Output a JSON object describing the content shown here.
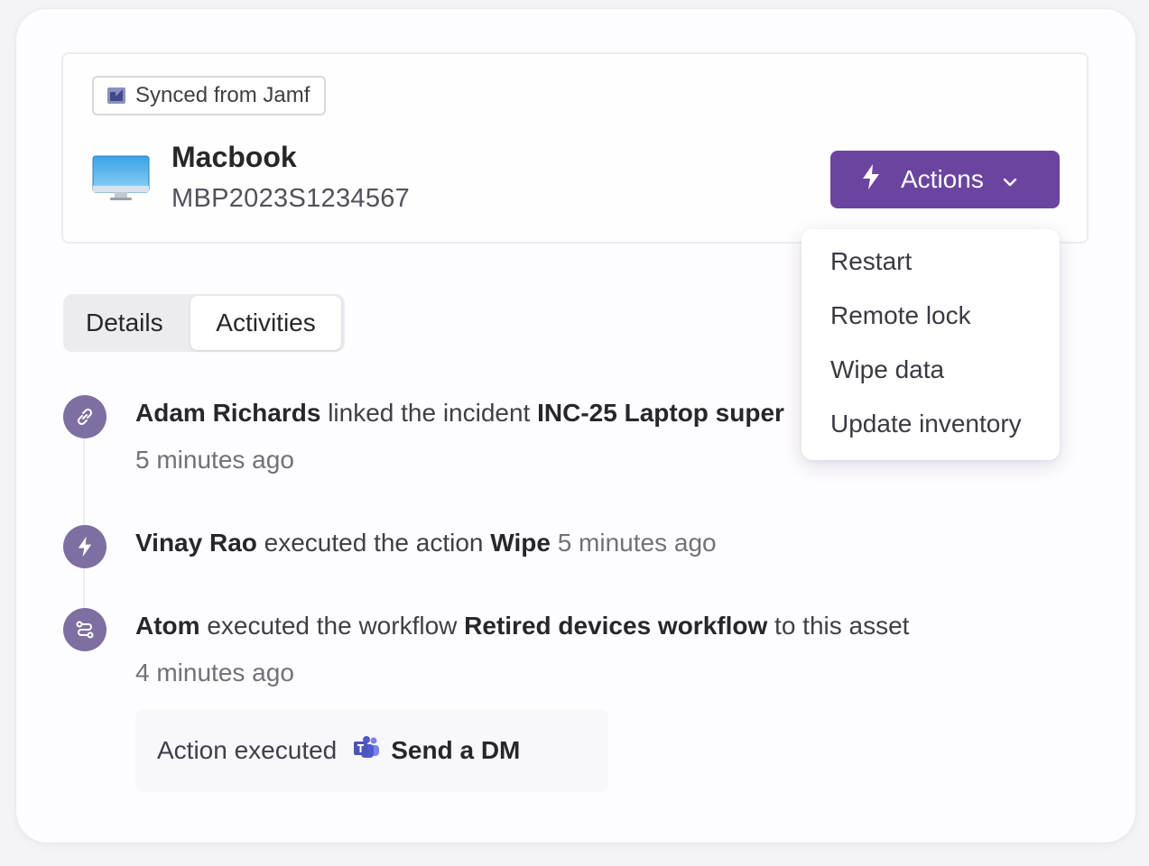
{
  "asset": {
    "sync_badge": "Synced from Jamf",
    "name": "Macbook",
    "serial": "MBP2023S1234567",
    "actions_label": "Actions"
  },
  "actions_menu": {
    "items": [
      "Restart",
      "Remote lock",
      "Wipe data",
      "Update inventory"
    ]
  },
  "tabs": {
    "details": "Details",
    "activities": "Activities",
    "active": "Activities"
  },
  "activities": [
    {
      "icon": "link-icon",
      "actor": "Adam Richards",
      "verb": "linked the incident",
      "object": "INC-25 Laptop super",
      "time": "5 minutes ago"
    },
    {
      "icon": "bolt-icon",
      "actor": "Vinay Rao",
      "verb": "executed the action",
      "object": "Wipe",
      "time": "5 minutes ago"
    },
    {
      "icon": "workflow-icon",
      "actor": "Atom",
      "verb": "executed the workflow",
      "object": "Retired devices workflow",
      "suffix": "to this asset",
      "time": "4 minutes ago",
      "detail": {
        "label": "Action executed",
        "icon": "teams-icon",
        "value": "Send a DM"
      }
    }
  ],
  "colors": {
    "accent": "#6b44a0",
    "timeline_icon": "#7d6fa1"
  }
}
